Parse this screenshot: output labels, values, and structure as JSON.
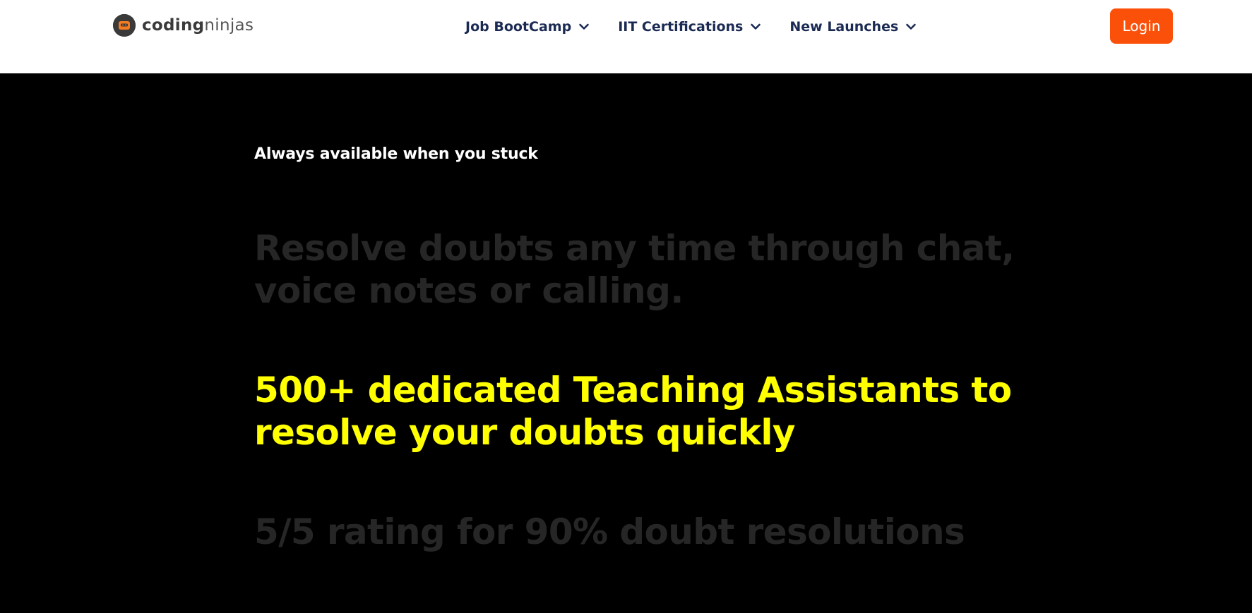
{
  "header": {
    "logo": {
      "text_bold": "coding",
      "text_light": "ninjas",
      "icon": "ninja-logo-icon"
    },
    "nav": [
      {
        "label": "Job BootCamp",
        "icon": "chevron-down-icon"
      },
      {
        "label": "IIT Certifications",
        "icon": "chevron-down-icon"
      },
      {
        "label": "New Launches",
        "icon": "chevron-down-icon"
      }
    ],
    "login_label": "Login"
  },
  "main": {
    "kicker": "Always available when you stuck",
    "lines": [
      {
        "text": "Resolve doubts any time through chat, voice notes or calling.",
        "state": "inactive"
      },
      {
        "text": "500+ dedicated Teaching Assistants to resolve your doubts quickly",
        "state": "active"
      },
      {
        "text": "5/5 rating for 90% doubt resolutions",
        "state": "inactive"
      }
    ]
  },
  "colors": {
    "accent": "#fa500a",
    "highlight": "#ffff00",
    "dimmed_text": "#262626",
    "nav_text": "#1a2a52",
    "background": "#000000"
  }
}
